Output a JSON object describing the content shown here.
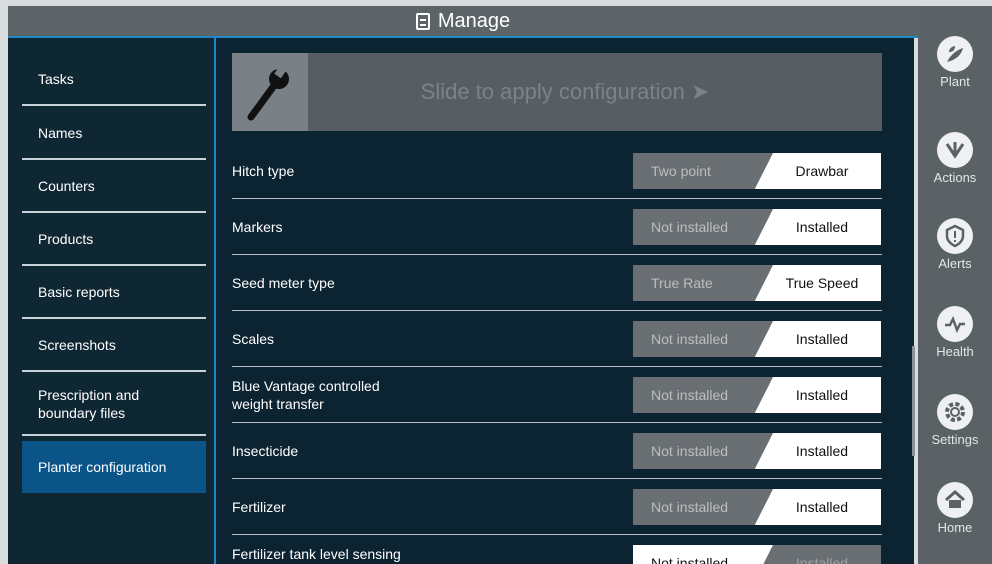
{
  "window": {
    "title": "Manage",
    "title_icon": "document-icon"
  },
  "nav": {
    "items": [
      {
        "label": "Tasks",
        "active": false
      },
      {
        "label": "Names",
        "active": false
      },
      {
        "label": "Counters",
        "active": false
      },
      {
        "label": "Products",
        "active": false
      },
      {
        "label": "Basic reports",
        "active": false
      },
      {
        "label": "Screenshots",
        "active": false
      },
      {
        "label": "Prescription and\nboundary files",
        "active": false
      },
      {
        "label": "Planter configuration",
        "active": true
      }
    ]
  },
  "slider": {
    "text": "Slide to apply configuration ➤",
    "icon": "wrench-icon"
  },
  "settings": [
    {
      "label": "Hitch type",
      "left": "Two point",
      "right": "Drawbar",
      "selected": "right"
    },
    {
      "label": "Markers",
      "left": "Not installed",
      "right": "Installed",
      "selected": "right"
    },
    {
      "label": "Seed meter type",
      "left": "True Rate",
      "right": "True Speed",
      "selected": "right"
    },
    {
      "label": "Scales",
      "left": "Not installed",
      "right": "Installed",
      "selected": "right"
    },
    {
      "label": "Blue Vantage controlled\nweight transfer",
      "left": "Not installed",
      "right": "Installed",
      "selected": "right"
    },
    {
      "label": "Insecticide",
      "left": "Not installed",
      "right": "Installed",
      "selected": "right"
    },
    {
      "label": "Fertilizer",
      "left": "Not installed",
      "right": "Installed",
      "selected": "right"
    },
    {
      "label": "Fertilizer tank level sensing",
      "left": "Not installed",
      "right": "Installed",
      "selected": "left"
    }
  ],
  "rail": [
    {
      "label": "Plant",
      "icon": "plant-icon"
    },
    {
      "label": "Actions",
      "icon": "actions-icon"
    },
    {
      "label": "Alerts",
      "icon": "alert-shield-icon"
    },
    {
      "label": "Health",
      "icon": "health-pulse-icon"
    },
    {
      "label": "Settings",
      "icon": "gear-icon"
    },
    {
      "label": "Home",
      "icon": "home-icon"
    }
  ],
  "colors": {
    "accent": "#1f86c8",
    "active_nav": "#0b5488",
    "panel": "#0c2332"
  }
}
